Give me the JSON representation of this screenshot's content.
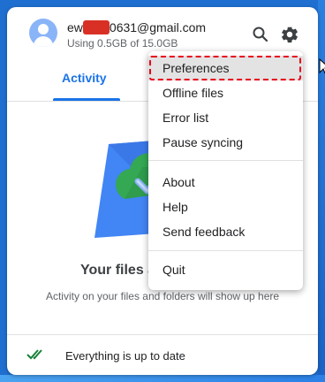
{
  "account": {
    "email_prefix": "ew",
    "email_redacted": "xxxx",
    "email_suffix": "0631@gmail.com",
    "usage": "Using 0.5GB of 15.0GB"
  },
  "header": {
    "search_icon": "search-icon",
    "settings_icon": "gear-icon"
  },
  "tabs": [
    {
      "label": "Activity",
      "active": true
    }
  ],
  "empty_state": {
    "title": "Your files a",
    "subtitle": "Activity on your files and folders will show up here"
  },
  "footer": {
    "status": "Everything is up to date"
  },
  "menu": {
    "group1": [
      "Preferences",
      "Offline files",
      "Error list",
      "Pause syncing"
    ],
    "group2": [
      "About",
      "Help",
      "Send feedback"
    ],
    "group3": [
      "Quit"
    ]
  },
  "colors": {
    "accent": "#1a73e8",
    "highlight": "#e8001c",
    "check": "#188038"
  }
}
